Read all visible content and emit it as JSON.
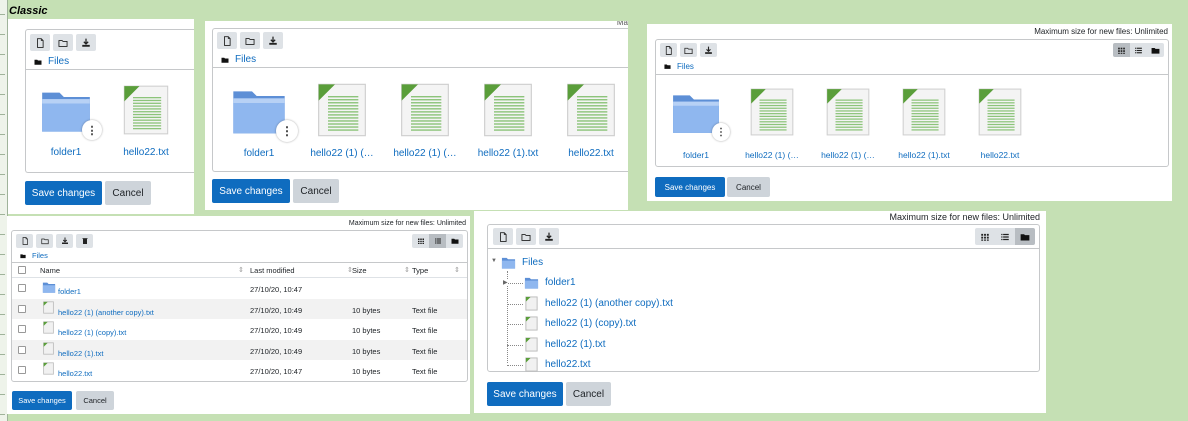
{
  "header": {
    "label": "Classic"
  },
  "common": {
    "path_label": "Files",
    "save_label": "Save changes",
    "cancel_label": "Cancel",
    "max_size": "Maximum size for new files: Unlimited",
    "max_size_cropped": "Ma"
  },
  "icons": {
    "toolbar": [
      "new-file-icon",
      "new-folder-icon",
      "download-icon",
      "delete-icon"
    ],
    "views": [
      "grid-view-icon",
      "list-view-icon",
      "tree-view-icon"
    ],
    "folder": "folder-icon",
    "file": "text-file-icon",
    "more": "kebab-menu-icon"
  },
  "colors": {
    "accent": "#0f6cbf",
    "background": "#c5e0b4",
    "border": "#c6c8ca",
    "button_grey": "#ced4da"
  },
  "panel1": {
    "files": [
      {
        "name": "folder1",
        "type": "folder"
      },
      {
        "name": "hello22.txt",
        "type": "file"
      }
    ]
  },
  "panel2": {
    "files": [
      {
        "name": "folder1",
        "type": "folder"
      },
      {
        "name": "hello22 (1) (…",
        "type": "file"
      },
      {
        "name": "hello22 (1) (…",
        "type": "file"
      },
      {
        "name": "hello22 (1).txt",
        "type": "file"
      },
      {
        "name": "hello22.txt",
        "type": "file"
      }
    ]
  },
  "panel3": {
    "active_view": "grid",
    "files": [
      {
        "name": "folder1",
        "type": "folder"
      },
      {
        "name": "hello22 (1) (…",
        "type": "file"
      },
      {
        "name": "hello22 (1) (…",
        "type": "file"
      },
      {
        "name": "hello22 (1).txt",
        "type": "file"
      },
      {
        "name": "hello22.txt",
        "type": "file"
      }
    ]
  },
  "panel4": {
    "active_view": "list",
    "columns": [
      "Name",
      "Last modified",
      "Size",
      "Type"
    ],
    "rows": [
      {
        "name": "folder1",
        "modified": "27/10/20, 10:47",
        "size": "",
        "type": "",
        "kind": "folder"
      },
      {
        "name": "hello22 (1) (another copy).txt",
        "modified": "27/10/20, 10:49",
        "size": "10 bytes",
        "type": "Text file",
        "kind": "file"
      },
      {
        "name": "hello22 (1) (copy).txt",
        "modified": "27/10/20, 10:49",
        "size": "10 bytes",
        "type": "Text file",
        "kind": "file"
      },
      {
        "name": "hello22 (1).txt",
        "modified": "27/10/20, 10:49",
        "size": "10 bytes",
        "type": "Text file",
        "kind": "file"
      },
      {
        "name": "hello22.txt",
        "modified": "27/10/20, 10:47",
        "size": "10 bytes",
        "type": "Text file",
        "kind": "file"
      }
    ]
  },
  "panel5": {
    "active_view": "tree",
    "root": "Files",
    "items": [
      {
        "name": "folder1",
        "kind": "folder"
      },
      {
        "name": "hello22 (1) (another copy).txt",
        "kind": "file"
      },
      {
        "name": "hello22 (1) (copy).txt",
        "kind": "file"
      },
      {
        "name": "hello22 (1).txt",
        "kind": "file"
      },
      {
        "name": "hello22.txt",
        "kind": "file"
      }
    ]
  }
}
